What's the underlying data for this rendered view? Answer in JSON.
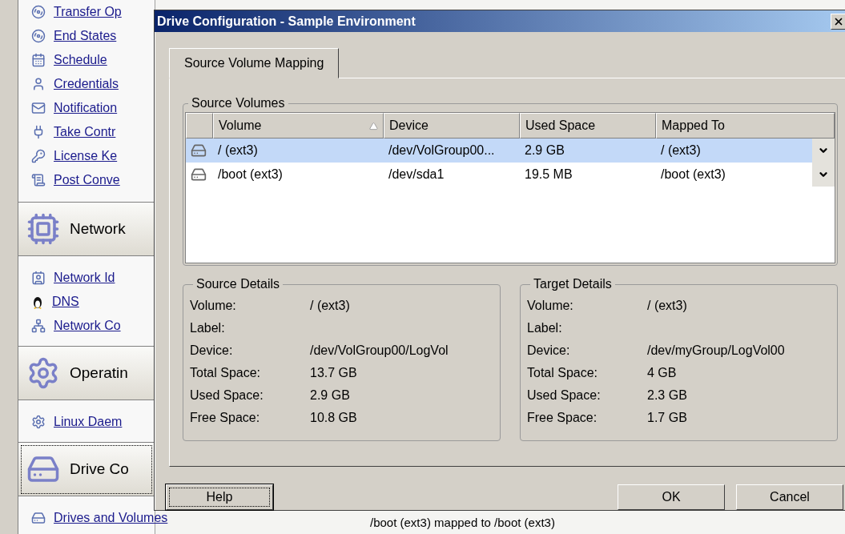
{
  "sidebar": {
    "sections": [
      {
        "links": [
          {
            "label": "Transfer Op"
          },
          {
            "label": "End States"
          },
          {
            "label": "Schedule"
          },
          {
            "label": "Credentials"
          },
          {
            "label": "Notification"
          },
          {
            "label": "Take Contr"
          },
          {
            "label": "License Ke"
          },
          {
            "label": "Post Conve"
          }
        ]
      },
      {
        "title": "Network",
        "selected": false,
        "links": [
          {
            "label": "Network Id"
          },
          {
            "label": "DNS"
          },
          {
            "label": "Network Co"
          }
        ]
      },
      {
        "title": "Operatin",
        "selected": false,
        "links": [
          {
            "label": "Linux Daem"
          }
        ]
      },
      {
        "title": "Drive Co",
        "selected": true,
        "links": [
          {
            "label": "Drives and Volumes"
          }
        ]
      }
    ]
  },
  "background_log": [
    "/boot (ext3) mapped to /boot (ext3)"
  ],
  "dialog": {
    "title": "Drive Configuration - Sample Environment",
    "tabs": [
      {
        "label": "Source Volume Mapping",
        "selected": true
      }
    ],
    "source_volumes": {
      "title": "Source Volumes",
      "columns": [
        {
          "label": "Volume",
          "sorted": true
        },
        {
          "label": "Device",
          "sorted": false
        },
        {
          "label": "Used Space",
          "sorted": false
        },
        {
          "label": "Mapped To",
          "sorted": false
        }
      ],
      "rows": [
        {
          "volume": "/ (ext3)",
          "device": "/dev/VolGroup00...",
          "used_space": "2.9 GB",
          "mapped_to": "/ (ext3)",
          "selected": true
        },
        {
          "volume": "/boot (ext3)",
          "device": "/dev/sda1",
          "used_space": "19.5 MB",
          "mapped_to": "/boot (ext3)",
          "selected": false
        }
      ]
    },
    "details": [
      {
        "title": "Source Details",
        "rows": [
          {
            "label": "Volume:",
            "value": "/ (ext3)"
          },
          {
            "label": "Label:"
          },
          {
            "label": "Device:",
            "value": "/dev/VolGroup00/LogVol"
          },
          {
            "label": "Total Space:",
            "value": "13.7 GB"
          },
          {
            "label": "Used Space:",
            "value": "2.9 GB"
          },
          {
            "label": "Free Space:",
            "value": "10.8 GB"
          }
        ]
      },
      {
        "title": "Target Details",
        "rows": [
          {
            "label": "Volume:",
            "value": "/ (ext3)"
          },
          {
            "label": "Label:"
          },
          {
            "label": "Device:",
            "value": "/dev/myGroup/LogVol00"
          },
          {
            "label": "Total Space:",
            "value": "4 GB"
          },
          {
            "label": "Used Space:",
            "value": "2.3 GB"
          },
          {
            "label": "Free Space:",
            "value": "1.7 GB"
          }
        ]
      }
    ],
    "buttons": [
      {
        "label": "Help",
        "focused": true
      },
      {
        "label": "OK",
        "focused": false
      },
      {
        "label": "Cancel",
        "focused": false
      }
    ]
  }
}
